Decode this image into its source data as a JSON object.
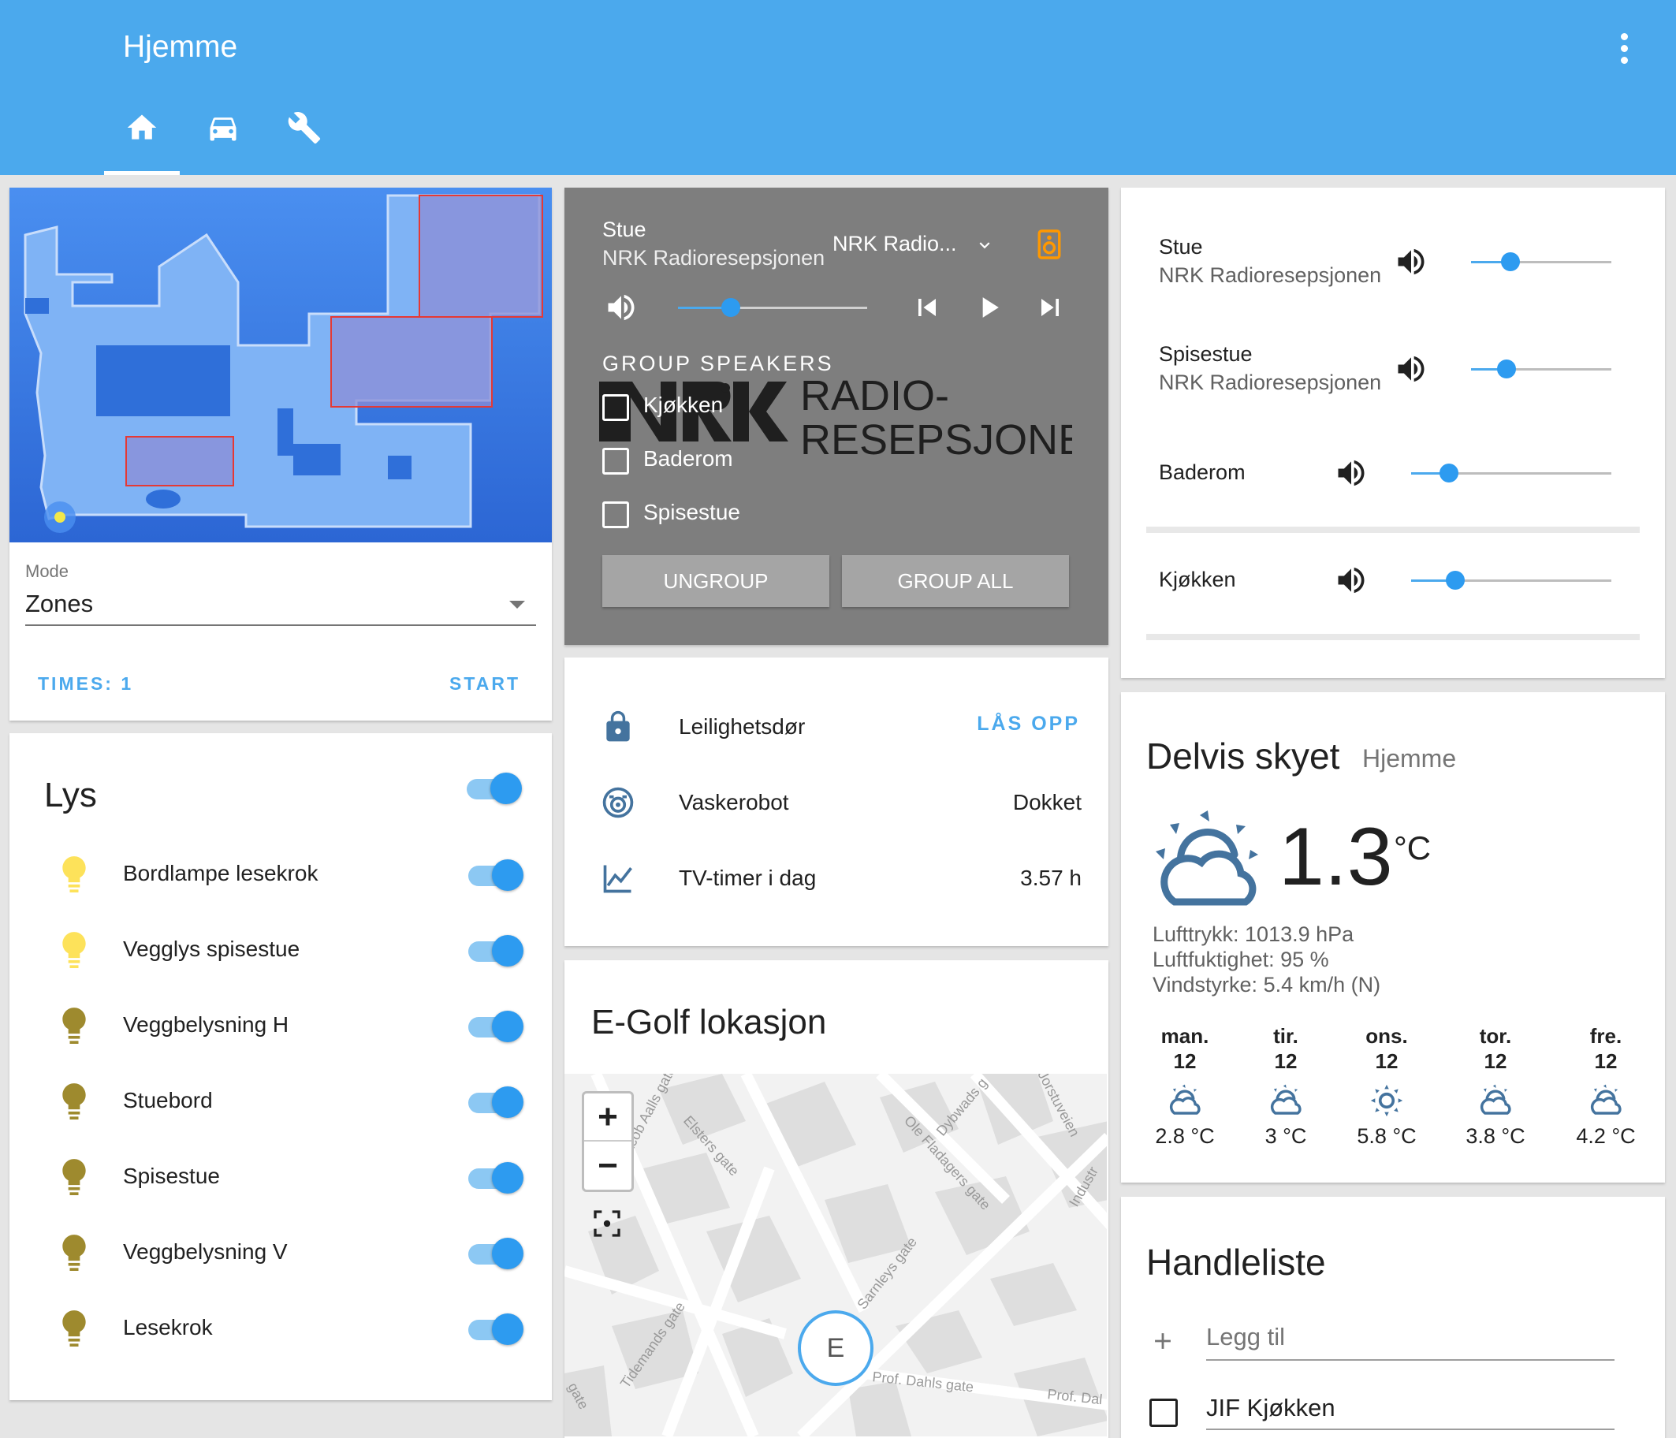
{
  "header": {
    "title": "Hjemme",
    "tabs": [
      {
        "icon": "home-icon",
        "active": true
      },
      {
        "icon": "car-icon",
        "active": false
      },
      {
        "icon": "wrench-icon",
        "active": false
      }
    ]
  },
  "vacuum": {
    "mode_label": "Mode",
    "mode_value": "Zones",
    "times_label": "TIMES: 1",
    "start_label": "START"
  },
  "lights": {
    "title": "Lys",
    "master_on": true,
    "items": [
      {
        "name": "Bordlampe lesekrok",
        "on": true,
        "color": "#fde25a"
      },
      {
        "name": "Vegglys spisestue",
        "on": true,
        "color": "#fde25a"
      },
      {
        "name": "Veggbelysning H",
        "on": true,
        "color": "#9e8a2e"
      },
      {
        "name": "Stuebord",
        "on": true,
        "color": "#9e8a2e"
      },
      {
        "name": "Spisestue",
        "on": true,
        "color": "#9e8a2e"
      },
      {
        "name": "Veggbelysning V",
        "on": true,
        "color": "#9e8a2e"
      },
      {
        "name": "Lesekrok",
        "on": true,
        "color": "#9e8a2e"
      }
    ]
  },
  "media": {
    "room": "Stue",
    "station": "NRK Radioresepsjonen",
    "source": "NRK Radio...",
    "volume": 0.28,
    "group_heading": "GROUP SPEAKERS",
    "logo_line1": "RADIO-",
    "logo_line2": "RESEPSJONEN",
    "speakers": [
      "Kjøkken",
      "Baderom",
      "Spisestue"
    ],
    "ungroup_label": "UNGROUP",
    "group_all_label": "GROUP ALL"
  },
  "entities": [
    {
      "icon": "lock-icon",
      "name": "Leilighetsdør",
      "action": "LÅS OPP"
    },
    {
      "icon": "robot-vacuum-icon",
      "name": "Vaskerobot",
      "value": "Dokket"
    },
    {
      "icon": "chart-line-icon",
      "name": "TV-timer i dag",
      "value": "3.57 h"
    }
  ],
  "map_card": {
    "title": "E-Golf lokasjon",
    "zoom_in": "+",
    "zoom_out": "−",
    "marker_label": "E",
    "streets": [
      "Jacob Aalls gate",
      "Elsters gate",
      "Dybwads g",
      "Ole Fladagers gate",
      "Jorstuveien",
      "Industr",
      "Sarnleys gate",
      "Tidemands gate",
      "Prof. Dahls gate",
      "Prof. Dal",
      "gate"
    ]
  },
  "volumes": [
    {
      "name": "Stue",
      "sub": "NRK Radioresepsjonen",
      "level": 0.28
    },
    {
      "name": "Spisestue",
      "sub": "NRK Radioresepsjonen",
      "level": 0.25
    },
    {
      "name": "Baderom",
      "level": 0.19
    },
    {
      "name": "Kjøkken",
      "level": 0.22
    }
  ],
  "weather": {
    "condition": "Delvis skyet",
    "location": "Hjemme",
    "temp": "1.3",
    "unit": "°C",
    "pressure": "Lufttrykk: 1013.9 hPa",
    "humidity": "Luftfuktighet: 95 %",
    "wind": "Vindstyrke: 5.4 km/h (N)",
    "forecast": [
      {
        "day": "man.",
        "date": "12",
        "icon": "partly-cloudy-icon",
        "temp": "2.8 °C"
      },
      {
        "day": "tir.",
        "date": "12",
        "icon": "partly-cloudy-icon",
        "temp": "3 °C"
      },
      {
        "day": "ons.",
        "date": "12",
        "icon": "sunny-icon",
        "temp": "5.8 °C"
      },
      {
        "day": "tor.",
        "date": "12",
        "icon": "partly-cloudy-icon",
        "temp": "3.8 °C"
      },
      {
        "day": "fre.",
        "date": "12",
        "icon": "partly-cloudy-icon",
        "temp": "4.2 °C"
      }
    ]
  },
  "shopping": {
    "title": "Handleliste",
    "add_placeholder": "Legg til",
    "items": [
      {
        "name": "JIF Kjøkken",
        "checked": false
      }
    ]
  },
  "colors": {
    "header": "#4ba9ed",
    "accent": "#2d9bf0",
    "media_bg": "#7e7e7e",
    "background": "#e5e5e5",
    "speaker_icon": "#ff9800"
  }
}
